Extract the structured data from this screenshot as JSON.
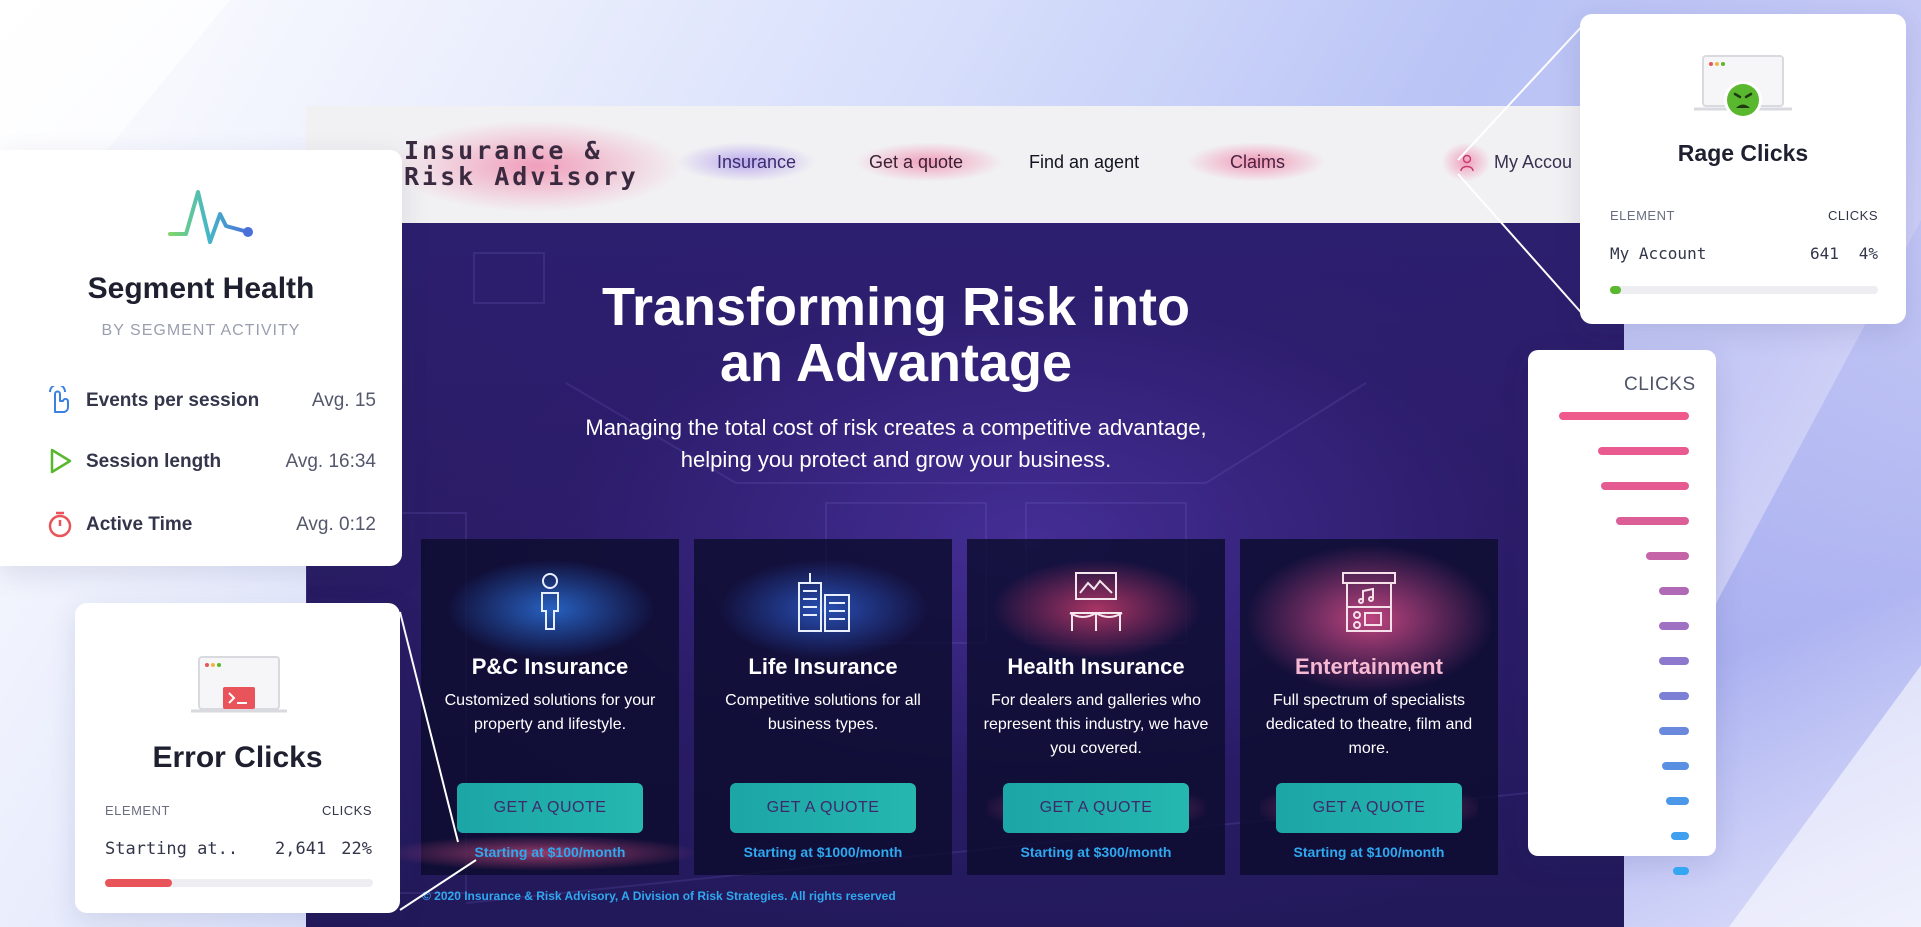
{
  "site": {
    "brand": "Insurance &\nRisk Advisory",
    "nav": [
      {
        "label": "Insurance",
        "color": "#3b2b6e"
      },
      {
        "label": "Get a quote",
        "color": "#3a1f33"
      },
      {
        "label": "Find an agent",
        "color": "#141420"
      },
      {
        "label": "Claims",
        "color": "#4b2240"
      },
      {
        "label": "My Accou",
        "color": "#3a3050"
      }
    ],
    "hero_title": "Transforming Risk into an Advantage",
    "hero_sub": "Managing the total cost of risk creates a competitive advantage, helping you protect and grow your business.",
    "cards": [
      {
        "title": "P&C Insurance",
        "desc": "Customized solutions for your property and lifestyle.",
        "button": "GET A QUOTE",
        "price": "Starting at $100/month",
        "icon": "person-icon",
        "glow": "#2b6fd8"
      },
      {
        "title": "Life Insurance",
        "desc": "Competitive solutions for all business types.",
        "button": "GET A QUOTE",
        "price": "Starting at $1000/month",
        "icon": "buildings-icon",
        "glow": "#2b5ac8"
      },
      {
        "title": "Health Insurance",
        "desc": "For dealers and galleries who represent this industry, we have you covered.",
        "button": "GET A QUOTE",
        "price": "Starting at $300/month",
        "icon": "gallery-icon",
        "glow": "#c23a6a"
      },
      {
        "title": "Entertainment",
        "desc": "Full spectrum of specialists dedicated to theatre, film and more.",
        "button": "GET A QUOTE",
        "price": "Starting at $100/month",
        "icon": "stage-icon",
        "glow": "#d04a86"
      }
    ],
    "footer": "© 2020 Insurance & Risk Advisory, A Division of Risk Strategies. All rights reserved"
  },
  "segment": {
    "title": "Segment Health",
    "subtitle": "BY SEGMENT ACTIVITY",
    "metrics": [
      {
        "label": "Events per session",
        "value": "Avg. 15",
        "icon": "pointer-hand-icon"
      },
      {
        "label": "Session length",
        "value": "Avg. 16:34",
        "icon": "play-icon"
      },
      {
        "label": "Active Time",
        "value": "Avg. 0:12",
        "icon": "stopwatch-icon"
      }
    ]
  },
  "error_clicks": {
    "title": "Error Clicks",
    "col_element": "ELEMENT",
    "col_clicks": "CLICKS",
    "row_element": "Starting at..",
    "row_clicks": "2,641",
    "row_pct": "22%",
    "fill": 0.25,
    "fill_color": "#e8545a"
  },
  "rage_clicks": {
    "title": "Rage Clicks",
    "col_element": "ELEMENT",
    "col_clicks": "CLICKS",
    "row_element": "My Account",
    "row_clicks": "641",
    "row_pct": "4%",
    "fill": 0.04,
    "fill_color": "#5ab82e"
  },
  "clicks_panel": {
    "header": "CLICKS",
    "bars": [
      1.0,
      0.7,
      0.68,
      0.56,
      0.33,
      0.23,
      0.23,
      0.23,
      0.23,
      0.23,
      0.21,
      0.18,
      0.14,
      0.12
    ],
    "colors": [
      "#ef5a8c",
      "#e95a90",
      "#e65a92",
      "#dc5e97",
      "#c564a6",
      "#b06ab5",
      "#a070c2",
      "#8c78cc",
      "#7c80d4",
      "#6a88dc",
      "#5a90e2",
      "#4c98e8",
      "#3ea0ee",
      "#34a6f2"
    ]
  }
}
